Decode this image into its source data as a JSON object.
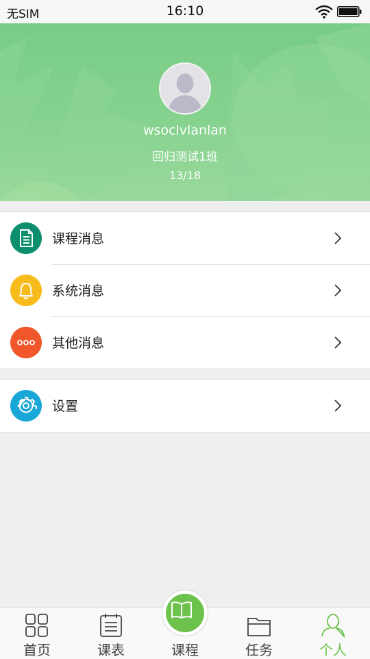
{
  "status_bar": {
    "carrier": "无SIM",
    "time": "16:10"
  },
  "profile": {
    "username": "wsoclvlanlan",
    "class": "回归测试1班",
    "progress": "13/18"
  },
  "messages": [
    {
      "label": "课程消息",
      "icon": "document-icon",
      "color": "#0d8f6d"
    },
    {
      "label": "系统消息",
      "icon": "bell-icon",
      "color": "#f7bb1c"
    },
    {
      "label": "其他消息",
      "icon": "more-dots-icon",
      "color": "#f0582c"
    }
  ],
  "settings": {
    "label": "设置",
    "icon": "gear-icon",
    "color": "#18a7d6"
  },
  "tabbar": [
    {
      "label": "首页",
      "icon": "grid-icon"
    },
    {
      "label": "课表",
      "icon": "notepad-icon"
    },
    {
      "label": "课程",
      "icon": "book-icon"
    },
    {
      "label": "任务",
      "icon": "folder-icon"
    },
    {
      "label": "个人",
      "icon": "person-icon",
      "active": true
    }
  ],
  "colors": {
    "accent": "#6cc24a",
    "header": "#7fcf88"
  }
}
